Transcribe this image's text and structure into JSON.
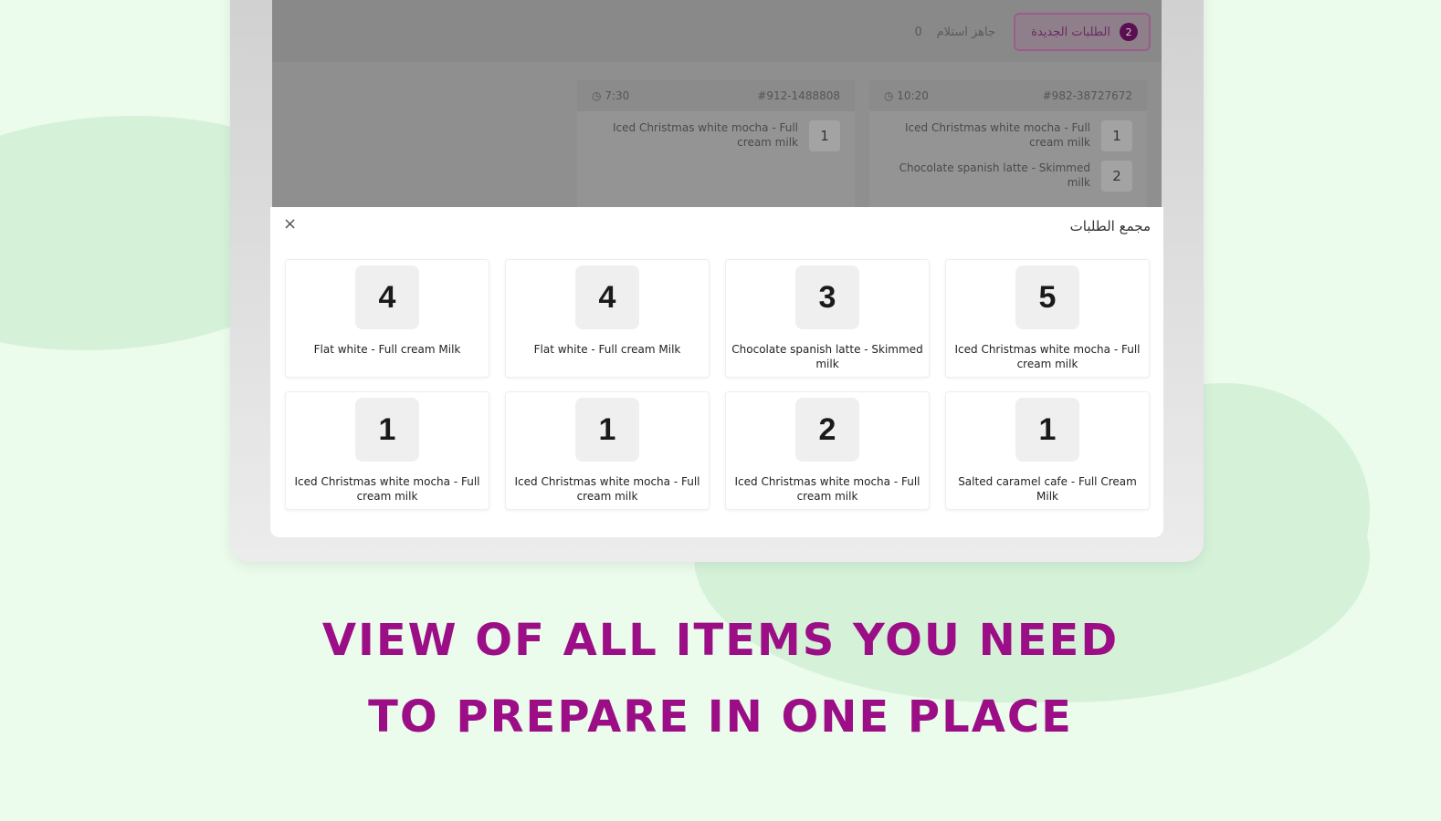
{
  "screen": {
    "tabs": [
      {
        "label": "الطلبات الجديدة",
        "count": "2"
      },
      {
        "label": "جاهز استلام",
        "count": "0"
      }
    ],
    "orders": [
      {
        "id": "#982-38727672",
        "time": "10:20",
        "lines": [
          {
            "name": "Iced Christmas white mocha - Full cream milk",
            "qty": "1"
          },
          {
            "name": "Chocolate spanish latte - Skimmed milk",
            "qty": "2"
          }
        ]
      },
      {
        "id": "#912-1488808",
        "time": "7:30",
        "lines": [
          {
            "name": "Iced Christmas white mocha - Full cream milk",
            "qty": "1"
          }
        ]
      }
    ]
  },
  "panel": {
    "title": "مجمع الطلبات",
    "close": "×",
    "items": [
      {
        "count": "4",
        "name": "Flat white - Full cream Milk"
      },
      {
        "count": "4",
        "name": "Flat white - Full cream Milk"
      },
      {
        "count": "3",
        "name": "Chocolate spanish latte - Skimmed milk"
      },
      {
        "count": "5",
        "name": "Iced Christmas white mocha - Full cream milk"
      },
      {
        "count": "1",
        "name": "Iced Christmas white mocha - Full cream milk"
      },
      {
        "count": "1",
        "name": "Iced Christmas white mocha - Full cream milk"
      },
      {
        "count": "2",
        "name": "Iced Christmas white mocha - Full cream milk"
      },
      {
        "count": "1",
        "name": "Salted caramel cafe - Full Cream Milk"
      }
    ]
  },
  "headline": {
    "line1": "VIEW OF ALL ITEMS YOU NEED",
    "line2": "TO PREPARE IN ONE PLACE"
  },
  "colors": {
    "background": "#ebfbec",
    "blob": "#d5f2d9",
    "headline": "#9b0e86",
    "accent": "#5a1050"
  }
}
